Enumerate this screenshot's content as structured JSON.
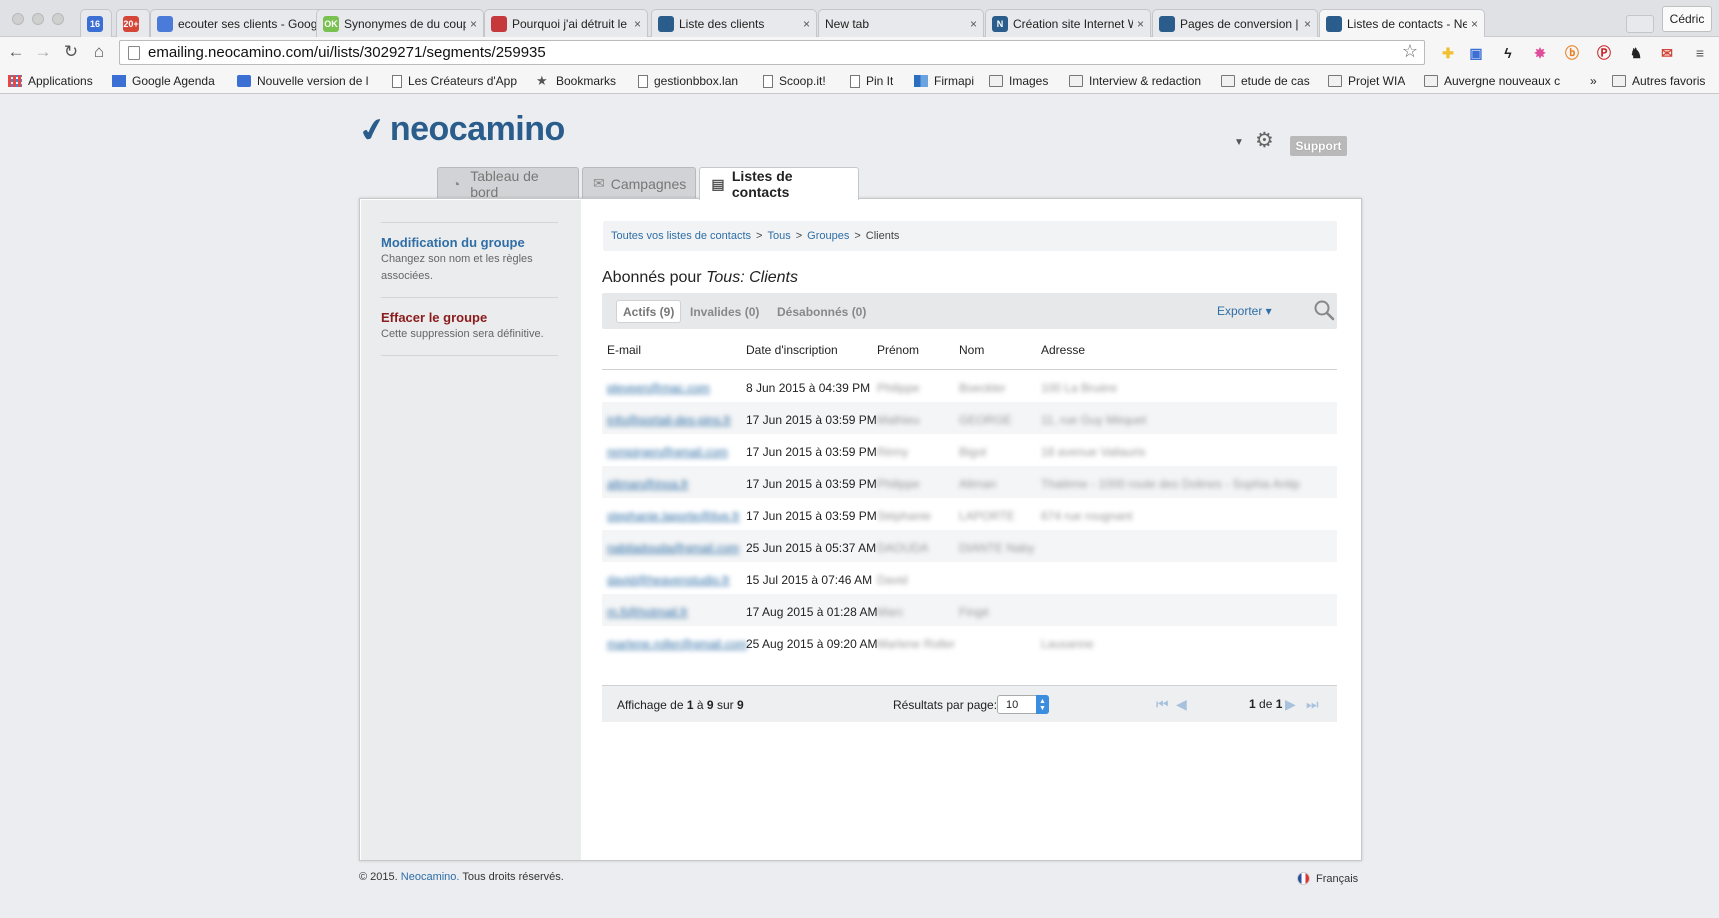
{
  "browser": {
    "tabs": [
      {
        "title": "",
        "icon": "calendar-icon",
        "color": "#3b6fd4",
        "badge": "16"
      },
      {
        "title": "",
        "icon": "gmail-icon",
        "color": "#d44638",
        "badge": "20+"
      },
      {
        "title": "ecouter ses clients - Goog",
        "icon": "docs-icon",
        "color": "#4a7bd8"
      },
      {
        "title": "Synonymes de du coup",
        "icon": "ok-icon",
        "color": "#79c150",
        "badge": "OK"
      },
      {
        "title": "Pourquoi j'ai détruit le site",
        "icon": "site-icon",
        "color": "#c5383b"
      },
      {
        "title": "Liste des clients",
        "icon": "neocamino-icon",
        "color": "#2a5d8c"
      },
      {
        "title": "New tab",
        "icon": "",
        "color": ""
      },
      {
        "title": "Création site Internet Word",
        "icon": "n-icon",
        "color": "#2a5d8c",
        "badge": "N"
      },
      {
        "title": "Pages de conversion | Ne",
        "icon": "neocamino-icon",
        "color": "#2a5d8c"
      },
      {
        "title": "Listes de contacts - Neoc",
        "icon": "neocamino-icon",
        "color": "#2a5d8c"
      }
    ],
    "close_glyph": "×",
    "profile_name": "Cédric",
    "url": "emailing.neocamino.com/ui/lists/3029271/segments/259935",
    "bookmarks": [
      {
        "label": "Applications",
        "type": "apps"
      },
      {
        "label": "Google Agenda",
        "type": "calendar"
      },
      {
        "label": "Nouvelle version de l",
        "type": "user"
      },
      {
        "label": "Les Créateurs d'App",
        "type": "file"
      },
      {
        "label": "Bookmarks",
        "type": "star"
      },
      {
        "label": "gestionbbox.lan",
        "type": "file"
      },
      {
        "label": "Scoop.it!",
        "type": "file"
      },
      {
        "label": "Pin It",
        "type": "file"
      },
      {
        "label": "Firmapi",
        "type": "chart"
      },
      {
        "label": "Images",
        "type": "folder"
      },
      {
        "label": "Interview & redaction",
        "type": "folder"
      },
      {
        "label": "etude de cas",
        "type": "folder"
      },
      {
        "label": "Projet WIA",
        "type": "folder"
      },
      {
        "label": "Auvergne nouveaux c",
        "type": "folder"
      },
      {
        "label": "Autres favoris",
        "type": "folder"
      }
    ],
    "more_bookmarks": "»"
  },
  "app": {
    "logo": "neocamino",
    "support_label": "Support",
    "tabs": [
      {
        "label": "Tableau de bord",
        "icon": "dashboard-icon"
      },
      {
        "label": "Campagnes",
        "icon": "envelope-icon"
      },
      {
        "label": "Listes de contacts",
        "icon": "contacts-icon"
      }
    ],
    "active_tab": "Listes de contacts"
  },
  "sidebar": {
    "edit_title": "Modification du groupe",
    "edit_desc": "Changez son nom et les règles associées.",
    "delete_title": "Effacer le groupe",
    "delete_desc": "Cette suppression sera définitive."
  },
  "breadcrumb": {
    "all_lists": "Toutes vos listes de contacts",
    "all": "Tous",
    "groups": "Groupes",
    "current": "Clients",
    "separator": ">"
  },
  "heading": {
    "prefix": "Abonnés pour",
    "name": "Tous: Clients"
  },
  "filters": {
    "active": "Actifs (9)",
    "invalid": "Invalides (0)",
    "unsubscribed": "Désabonnés (0)"
  },
  "export_label": "Exporter ▾",
  "table": {
    "columns": [
      "E-mail",
      "Date d'inscription",
      "Prénom",
      "Nom",
      "Adresse"
    ],
    "rows": [
      {
        "email": "pleveen@mac.com",
        "date": "8 Jun 2015 à 04:39 PM",
        "first": "Philippe",
        "last": "Boeckler",
        "address": "100 La Bruère"
      },
      {
        "email": "info@portail-des-pins.fr",
        "date": "17 Jun 2015 à 03:59 PM",
        "first": "Mathieu",
        "last": "GEORGE",
        "address": "11, rue Guy Mèquet"
      },
      {
        "email": "rempirgen@gmail.com",
        "date": "17 Jun 2015 à 03:59 PM",
        "first": "Rémy",
        "last": "Bigot",
        "address": "18 avenue Vallauris"
      },
      {
        "email": "altman@inoa.fr",
        "date": "17 Jun 2015 à 03:59 PM",
        "first": "Philippe",
        "last": "Altman",
        "address": "Thalème - 1000 route des Dolines - Sophia Antip"
      },
      {
        "email": "stephanie.laporte@live.fr",
        "date": "17 Jun 2015 à 03:59 PM",
        "first": "Stéphanie",
        "last": "LAPORTE",
        "address": "674 rue rougnant"
      },
      {
        "email": "nabiladouda@gmail.com",
        "date": "25 Jun 2015 à 05:37 AM",
        "first": "DAOUDA",
        "last": "DIANTE Naby",
        "address": ""
      },
      {
        "email": "david@heavenstudio.fr",
        "date": "15 Jul 2015 à 07:46 AM",
        "first": "David",
        "last": "",
        "address": ""
      },
      {
        "email": "m.fi@hotmail.fr",
        "date": "17 Aug 2015 à 01:28 AM",
        "first": "Marc",
        "last": "Fingé",
        "address": ""
      },
      {
        "email": "marlene.roller@gmail.com",
        "date": "25 Aug 2015 à 09:20 AM",
        "first": "Marlene Roller",
        "last": "",
        "address": "Lausanne"
      }
    ]
  },
  "pagination": {
    "showing": {
      "prefix": "Affichage de",
      "from": "1",
      "to_word": "à",
      "to": "9",
      "of_word": "sur",
      "total": "9"
    },
    "per_page_label": "Résultats par page:",
    "per_page_value": "10",
    "page_current": "1",
    "page_of": "de",
    "page_total": "1"
  },
  "footer": {
    "copyright_prefix": "© 2015.",
    "brand": "Neocamino.",
    "rights": "Tous droits réservés.",
    "language": "Français"
  },
  "colors": {
    "brand": "#2a5d8c",
    "link": "#2f6ea6",
    "danger": "#8a1c1c"
  }
}
